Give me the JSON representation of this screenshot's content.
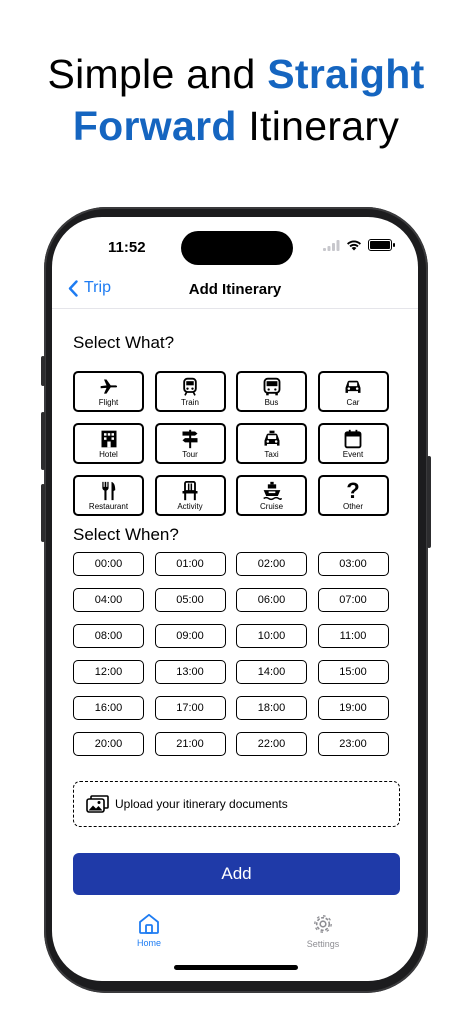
{
  "headline": {
    "part1": "Simple and ",
    "part2": "Straight",
    "part3": "Forward",
    "part4": " Itinerary"
  },
  "status": {
    "time": "11:52"
  },
  "nav": {
    "back_label": "Trip",
    "title": "Add Itinerary"
  },
  "what": {
    "title": "Select What?",
    "items": [
      {
        "label": "Flight",
        "icon": "airplane-icon"
      },
      {
        "label": "Train",
        "icon": "train-icon"
      },
      {
        "label": "Bus",
        "icon": "bus-icon"
      },
      {
        "label": "Car",
        "icon": "car-icon"
      },
      {
        "label": "Hotel",
        "icon": "hotel-icon"
      },
      {
        "label": "Tour",
        "icon": "signpost-icon"
      },
      {
        "label": "Taxi",
        "icon": "taxi-icon"
      },
      {
        "label": "Event",
        "icon": "calendar-icon"
      },
      {
        "label": "Restaurant",
        "icon": "fork-knife-icon"
      },
      {
        "label": "Activity",
        "icon": "chair-icon"
      },
      {
        "label": "Cruise",
        "icon": "ship-icon"
      },
      {
        "label": "Other",
        "icon": "question-mark-icon",
        "glyph": "?"
      }
    ]
  },
  "when": {
    "title": "Select When?",
    "times": [
      "00:00",
      "01:00",
      "02:00",
      "03:00",
      "04:00",
      "05:00",
      "06:00",
      "07:00",
      "08:00",
      "09:00",
      "10:00",
      "11:00",
      "12:00",
      "13:00",
      "14:00",
      "15:00",
      "16:00",
      "17:00",
      "18:00",
      "19:00",
      "20:00",
      "21:00",
      "22:00",
      "23:00"
    ]
  },
  "upload": {
    "label": "Upload your itinerary documents"
  },
  "add_button": {
    "label": "Add",
    "color": "#1f3aa8"
  },
  "tabs": {
    "home": "Home",
    "settings": "Settings"
  },
  "colors": {
    "accent": "#1e7cf2",
    "headline_blue": "#1565c0"
  }
}
